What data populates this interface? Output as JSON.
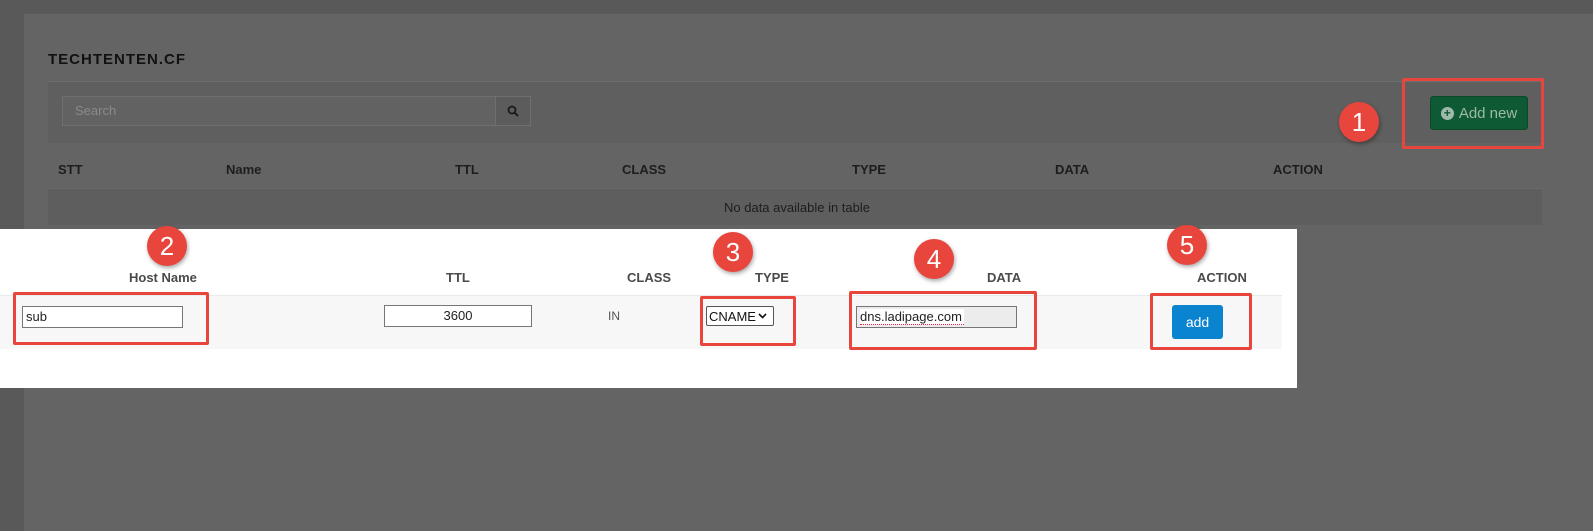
{
  "domain": "techtenten.cf",
  "title": "TECHTENTEN.CF",
  "search": {
    "placeholder": "Search"
  },
  "add_new_label": "Add new",
  "badges": [
    "1",
    "2",
    "3",
    "4",
    "5"
  ],
  "table": {
    "headers": [
      "STT",
      "Name",
      "TTL",
      "CLASS",
      "TYPE",
      "DATA",
      "ACTION"
    ],
    "empty_message": "No data available in table"
  },
  "form": {
    "headers": [
      "Host Name",
      "TTL",
      "CLASS",
      "TYPE",
      "DATA",
      "ACTION"
    ],
    "host_value": "sub",
    "ttl_value": "3600",
    "class_value": "IN",
    "type_selected": "CNAME",
    "data_value": "dns.ladipage.com",
    "add_label": "add"
  },
  "colors": {
    "highlight": "#e8453c",
    "add_new_bg": "#0e5a34",
    "add_bg": "#0a84cf"
  }
}
